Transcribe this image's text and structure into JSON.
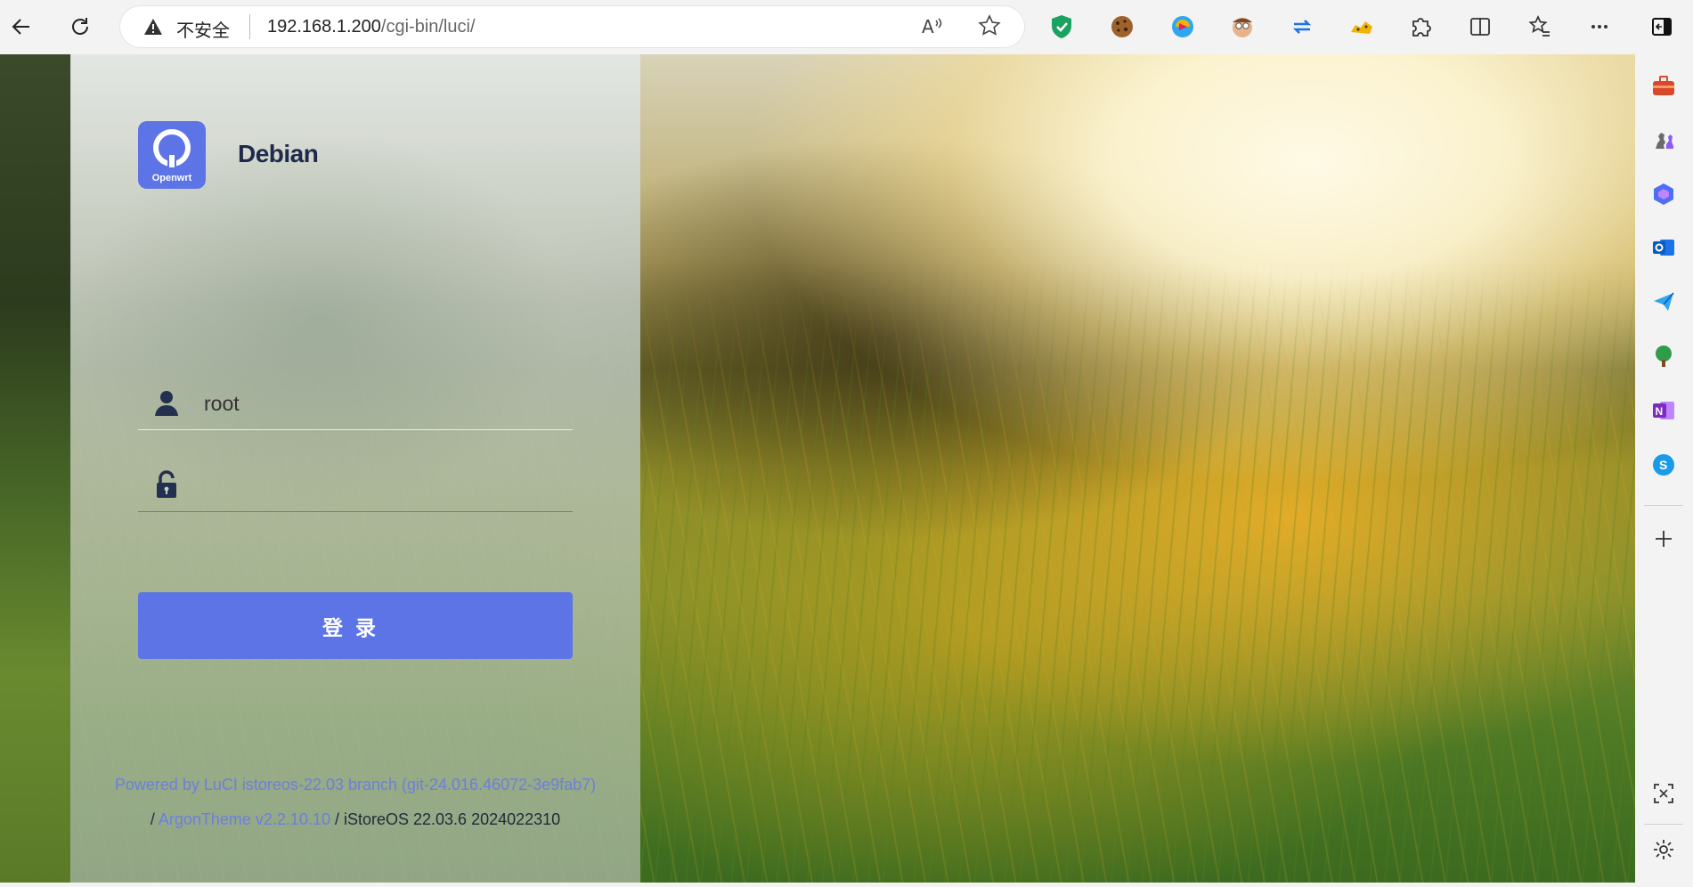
{
  "browser": {
    "security_label": "不安全",
    "url_host": "192.168.1.200",
    "url_path": "/cgi-bin/luci/",
    "read_aloud_label": "A̅",
    "colors": {
      "shield": "#1aa260",
      "copilot": "#1a73e8"
    }
  },
  "login": {
    "logo_text": "Openwrt",
    "brand": "Debian",
    "username_value": "root",
    "password_value": "",
    "login_button": "登录",
    "accent_color": "#5c74e6"
  },
  "footer": {
    "powered_by": "Powered by LuCI istoreos-22.03 branch (git-24.016.46072-3e9fab7)",
    "slash1": "/",
    "theme_link": "ArgonTheme v2.2.10.10",
    "os_version": "/ iStoreOS 22.03.6 2024022310"
  }
}
